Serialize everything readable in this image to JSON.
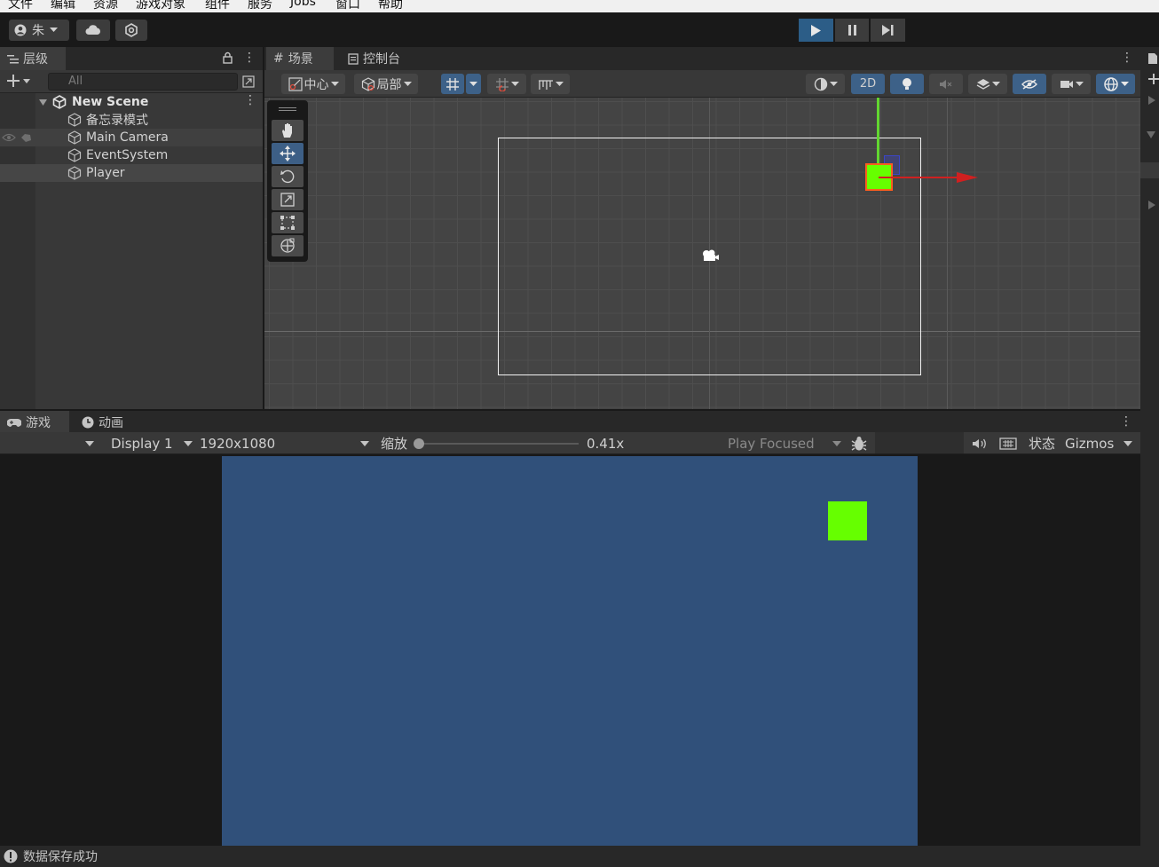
{
  "menu": [
    "文件",
    "编辑",
    "资源",
    "游戏对象",
    "组件",
    "服务",
    "Jobs",
    "窗口",
    "帮助"
  ],
  "toolbar": {
    "account_label": "朱",
    "icons": [
      "account-icon",
      "cloud-icon",
      "collab-icon",
      "play-icon",
      "pause-icon",
      "step-icon"
    ]
  },
  "hierarchy": {
    "tab": "层级",
    "search_placeholder": "All",
    "scene_name": "New Scene",
    "items": [
      "备忘录模式",
      "Main Camera",
      "EventSystem",
      "Player"
    ]
  },
  "scene": {
    "tabs": [
      "场景",
      "控制台"
    ],
    "pivot_label": "中心",
    "space_label": "局部",
    "mode_2d": "2D"
  },
  "game": {
    "tabs": [
      "游戏",
      "动画"
    ],
    "display": "Display 1",
    "resolution": "1920x1080",
    "scale_label": "缩放",
    "scale_value": "0.41x",
    "scale_fraction": 0.0,
    "play_focused": "Play Focused",
    "stats": "状态",
    "gizmos": "Gizmos"
  },
  "colors": {
    "player": "#66ff00",
    "game_background": "#30507a",
    "active_accent": "#2c5d87"
  },
  "status_text": "数据保存成功"
}
